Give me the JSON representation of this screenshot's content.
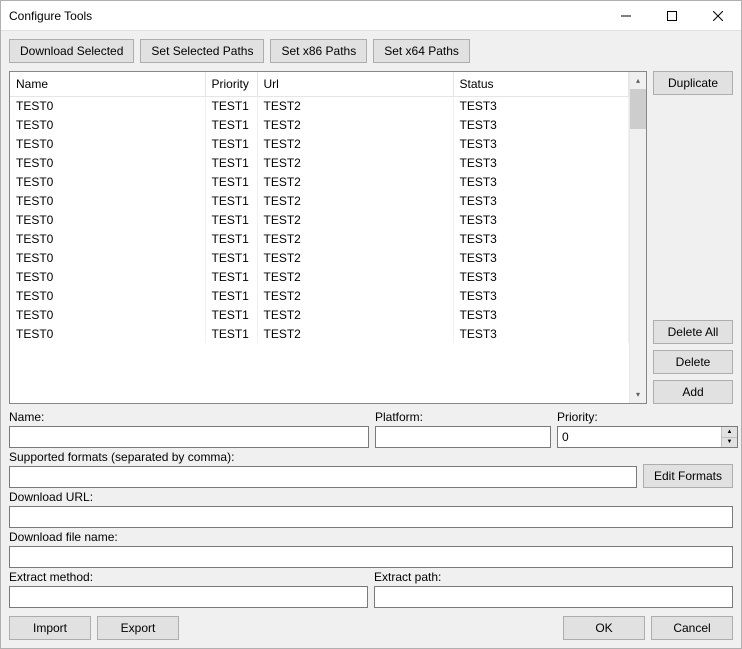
{
  "window": {
    "title": "Configure Tools"
  },
  "toolbar": {
    "download_selected": "Download Selected",
    "set_selected_paths": "Set Selected Paths",
    "set_x86_paths": "Set x86 Paths",
    "set_x64_paths": "Set x64 Paths"
  },
  "table": {
    "headers": {
      "name": "Name",
      "priority": "Priority",
      "url": "Url",
      "status": "Status"
    },
    "rows": [
      {
        "name": "TEST0",
        "priority": "TEST1",
        "url": "TEST2",
        "status": "TEST3"
      },
      {
        "name": "TEST0",
        "priority": "TEST1",
        "url": "TEST2",
        "status": "TEST3"
      },
      {
        "name": "TEST0",
        "priority": "TEST1",
        "url": "TEST2",
        "status": "TEST3"
      },
      {
        "name": "TEST0",
        "priority": "TEST1",
        "url": "TEST2",
        "status": "TEST3"
      },
      {
        "name": "TEST0",
        "priority": "TEST1",
        "url": "TEST2",
        "status": "TEST3"
      },
      {
        "name": "TEST0",
        "priority": "TEST1",
        "url": "TEST2",
        "status": "TEST3"
      },
      {
        "name": "TEST0",
        "priority": "TEST1",
        "url": "TEST2",
        "status": "TEST3"
      },
      {
        "name": "TEST0",
        "priority": "TEST1",
        "url": "TEST2",
        "status": "TEST3"
      },
      {
        "name": "TEST0",
        "priority": "TEST1",
        "url": "TEST2",
        "status": "TEST3"
      },
      {
        "name": "TEST0",
        "priority": "TEST1",
        "url": "TEST2",
        "status": "TEST3"
      },
      {
        "name": "TEST0",
        "priority": "TEST1",
        "url": "TEST2",
        "status": "TEST3"
      },
      {
        "name": "TEST0",
        "priority": "TEST1",
        "url": "TEST2",
        "status": "TEST3"
      },
      {
        "name": "TEST0",
        "priority": "TEST1",
        "url": "TEST2",
        "status": "TEST3"
      }
    ]
  },
  "side": {
    "duplicate": "Duplicate",
    "delete_all": "Delete All",
    "delete": "Delete",
    "add": "Add"
  },
  "form": {
    "name_label": "Name:",
    "name_value": "",
    "platform_label": "Platform:",
    "platform_value": "",
    "priority_label": "Priority:",
    "priority_value": "0",
    "supported_formats_label": "Supported formats (separated by comma):",
    "supported_formats_value": "",
    "edit_formats": "Edit Formats",
    "download_url_label": "Download URL:",
    "download_url_value": "",
    "download_filename_label": "Download file name:",
    "download_filename_value": "",
    "extract_method_label": "Extract method:",
    "extract_method_value": "",
    "extract_path_label": "Extract path:",
    "extract_path_value": ""
  },
  "footer": {
    "import": "Import",
    "export": "Export",
    "ok": "OK",
    "cancel": "Cancel"
  }
}
